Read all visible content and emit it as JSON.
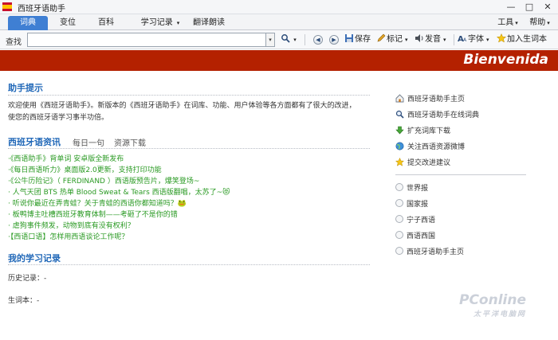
{
  "window": {
    "title": "西班牙语助手",
    "minimize": "—",
    "maximize": "□",
    "close": "✕"
  },
  "menu": {
    "tabs": [
      {
        "label": "词典"
      },
      {
        "label": "变位"
      },
      {
        "label": "百科"
      },
      {
        "label": "学习记录"
      },
      {
        "label": "翻译朗读"
      }
    ],
    "dropdown_arrow": "▾",
    "tools": "工具",
    "help": "帮助"
  },
  "toolbar": {
    "search_label": "查找",
    "search_value": "",
    "back": "◀",
    "forward": "▶",
    "save": "保存",
    "mark": "标记",
    "pronounce": "发音",
    "font": "字体",
    "add_vocab": "加入生词本"
  },
  "banner": {
    "text": "Bienvenida"
  },
  "assistant_tips": {
    "heading": "助手提示",
    "line1": "欢迎使用《西班牙语助手》。新版本的《西班牙语助手》在词库、功能、用户体验等各方面都有了很大的改进，",
    "line2": "使您的西班牙语学习事半功倍。"
  },
  "news": {
    "heading": "西班牙语资讯",
    "subtabs": [
      "每日一句",
      "资源下载"
    ],
    "items": [
      "·《西语助手》背单词 安卓版全新发布",
      "·《每日西语听力》桌面版2.0更新，支持打印功能",
      "·《公牛历险记》（ FERDINAND ）西语版预告片，爆笑登场~",
      "· 人气天团 BTS 热单 Blood Sweat & Tears 西语版翻唱，太苏了~😻",
      "· 听说你最近在弄青蛙？关于青蛙的西语你都知道吗？🐸",
      "· 板鸭博主吐槽西班牙教育体制——考砸了不是你的错",
      "· 虐狗事件频发，动物到底有没有权利？",
      "·【西语口语】怎样用西语谈论工作呢？"
    ]
  },
  "learning": {
    "heading": "我的学习记录",
    "history": "历史记录：-",
    "vocab": "生词本：-"
  },
  "side_links": [
    {
      "label": "西班牙语助手主页",
      "icon": "home-icon"
    },
    {
      "label": "西班牙语助手在线词典",
      "icon": "search-icon"
    },
    {
      "label": "扩充词库下载",
      "icon": "download-icon"
    },
    {
      "label": "关注西语资源微博",
      "icon": "globe-icon"
    },
    {
      "label": "提交改进建议",
      "icon": "star-icon"
    }
  ],
  "side_options": [
    {
      "label": "世界报"
    },
    {
      "label": "国家报"
    },
    {
      "label": "宁子西语"
    },
    {
      "label": "西语西国"
    },
    {
      "label": "西班牙语助手主页"
    }
  ],
  "watermark": {
    "main": "PConline",
    "sub": "太平洋电脑网"
  },
  "colors": {
    "banner": "#b42100",
    "active_tab": "#3f7fd3",
    "heading": "#2168b8",
    "news_link": "#2a9a23"
  }
}
